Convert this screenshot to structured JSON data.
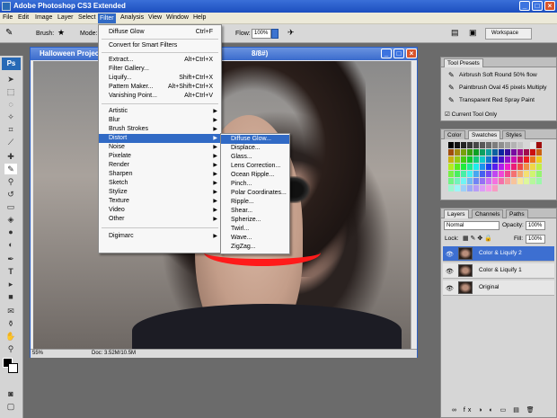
{
  "app": {
    "title": "Adobe Photoshop CS3 Extended"
  },
  "menubar": [
    "File",
    "Edit",
    "Image",
    "Layer",
    "Select",
    "Filter",
    "Analysis",
    "View",
    "Window",
    "Help"
  ],
  "options": {
    "brush_label": "Brush:",
    "mode_label": "Mode:",
    "flow_label": "Flow:",
    "flow_value": "100%",
    "workspace_label": "Workspace"
  },
  "document": {
    "title": "Halloween Project",
    "title_suffix": "8/8#)",
    "zoom": "55%",
    "doc_info": "Doc: 3.52M/10.5M"
  },
  "filter_menu": {
    "top": [
      {
        "label": "Diffuse Glow",
        "shortcut": "Ctrl+F"
      },
      {
        "label": "Convert for Smart Filters"
      },
      {
        "label": "Extract...",
        "shortcut": "Alt+Ctrl+X"
      },
      {
        "label": "Filter Gallery..."
      },
      {
        "label": "Liquify...",
        "shortcut": "Shift+Ctrl+X"
      },
      {
        "label": "Pattern Maker...",
        "shortcut": "Alt+Shift+Ctrl+X"
      },
      {
        "label": "Vanishing Point...",
        "shortcut": "Alt+Ctrl+V"
      }
    ],
    "groups": [
      "Artistic",
      "Blur",
      "Brush Strokes",
      "Distort",
      "Noise",
      "Pixelate",
      "Render",
      "Sharpen",
      "Sketch",
      "Stylize",
      "Texture",
      "Video",
      "Other"
    ],
    "bottom": [
      "Digimarc"
    ]
  },
  "distort_submenu": [
    "Diffuse Glow...",
    "Displace...",
    "Glass...",
    "Lens Correction...",
    "Ocean Ripple...",
    "Pinch...",
    "Polar Coordinates...",
    "Ripple...",
    "Shear...",
    "Spherize...",
    "Twirl...",
    "Wave...",
    "ZigZag..."
  ],
  "tool_presets": {
    "tab": "Tool Presets",
    "items": [
      "Airbrush Soft Round 50% flow",
      "Paintbrush Oval 45 pixels Multiply",
      "Transparent Red Spray Paint"
    ],
    "current_only": "Current Tool Only"
  },
  "swatches_panel": {
    "tabs": [
      "Color",
      "Swatches",
      "Styles"
    ]
  },
  "layers_panel": {
    "tabs": [
      "Layers",
      "Channels",
      "Paths"
    ],
    "blend_mode": "Normal",
    "opacity_label": "Opacity:",
    "opacity_value": "100%",
    "lock_label": "Lock:",
    "fill_label": "Fill:",
    "fill_value": "100%",
    "layers": [
      "Color & Liquify 2",
      "Color & Liquify 1",
      "Original"
    ]
  },
  "colors": {
    "highlight": "#316ac5",
    "title_blue": "#1c4fbf",
    "lip_red": "#ff1a1a"
  }
}
